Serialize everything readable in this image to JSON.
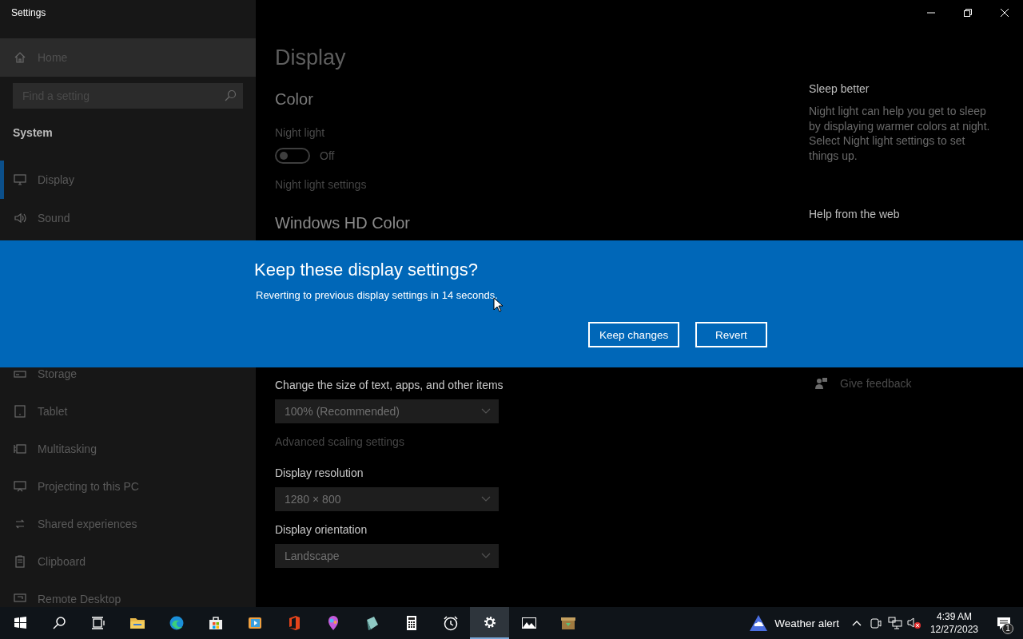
{
  "window": {
    "title": "Settings"
  },
  "sidebar": {
    "home": "Home",
    "search": {
      "placeholder": "Find a setting"
    },
    "section": "System",
    "items_top": [
      {
        "label": "Display",
        "selected": true
      },
      {
        "label": "Sound",
        "selected": false
      }
    ],
    "items_bottom": [
      {
        "label": "Storage",
        "selected": false
      },
      {
        "label": "Tablet",
        "selected": false
      },
      {
        "label": "Multitasking",
        "selected": false
      },
      {
        "label": "Projecting to this PC",
        "selected": false
      },
      {
        "label": "Shared experiences",
        "selected": false
      },
      {
        "label": "Clipboard",
        "selected": false
      },
      {
        "label": "Remote Desktop",
        "selected": false
      }
    ]
  },
  "page": {
    "title": "Display",
    "color_heading": "Color",
    "night_light": {
      "label": "Night light",
      "on": false,
      "state_text": "Off",
      "link": "Night light settings"
    },
    "hd_color_heading": "Windows HD Color",
    "scale": {
      "label": "Change the size of text, apps, and other items",
      "value": "100% (Recommended)",
      "link": "Advanced scaling settings"
    },
    "resolution": {
      "label": "Display resolution",
      "value": "1280 × 800"
    },
    "orientation": {
      "label": "Display orientation",
      "value": "Landscape"
    }
  },
  "aside": {
    "sleep_heading": "Sleep better",
    "sleep_text": "Night light can help you get to sleep by displaying warmer colors at night. Select Night light settings to set things up.",
    "help_heading": "Help from the web",
    "feedback": "Give feedback"
  },
  "dialog": {
    "title": "Keep these display settings?",
    "message": "Reverting to previous display settings in 14 seconds.",
    "buttons": [
      "Keep changes",
      "Revert"
    ]
  },
  "taskbar": {
    "apps": [
      {
        "selected": false
      },
      {
        "selected": false
      },
      {
        "selected": false
      },
      {
        "selected": false
      },
      {
        "selected": false
      },
      {
        "selected": false
      },
      {
        "selected": false
      },
      {
        "selected": false
      },
      {
        "selected": false
      },
      {
        "selected": false
      },
      {
        "selected": false
      },
      {
        "selected": false
      },
      {
        "selected": true
      },
      {
        "selected": false
      },
      {
        "selected": false
      }
    ],
    "weather": "Weather alert",
    "time": "4:39 AM",
    "date": "12/27/2023",
    "notifications": "1"
  }
}
